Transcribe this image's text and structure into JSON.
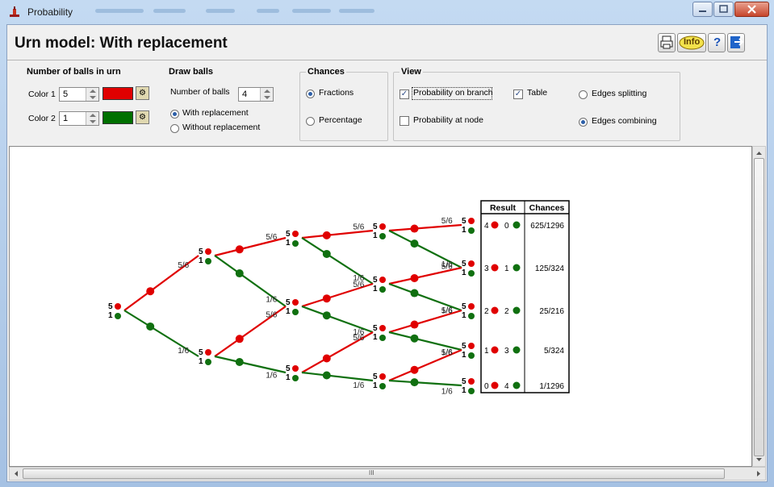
{
  "window": {
    "title": "Probability"
  },
  "header": {
    "title": "Urn model: With replacement",
    "info_label": "Info",
    "help_label": "?"
  },
  "balls": {
    "title": "Number of balls in urn",
    "color1": {
      "label": "Color 1",
      "value": "5",
      "color": "#e00000"
    },
    "color2": {
      "label": "Color 2",
      "value": "1",
      "color": "#007000"
    }
  },
  "draw": {
    "title": "Draw balls",
    "number_label": "Number of balls",
    "number_value": "4",
    "with_replacement": "With replacement",
    "without_replacement": "Without replacement"
  },
  "chances": {
    "title": "Chances",
    "fractions": "Fractions",
    "percentage": "Percentage"
  },
  "view": {
    "title": "View",
    "prob_branch": "Probability on branch",
    "prob_node": "Probability at node",
    "table": "Table",
    "edges_splitting": "Edges splitting",
    "edges_combining": "Edges combining"
  },
  "tree": {
    "red_color": "#e00000",
    "green_color": "#107010",
    "node_counts": {
      "red": "5",
      "green": "1"
    },
    "p_red": "5/6",
    "p_green": "1/6"
  },
  "table": {
    "headers": [
      "Result",
      "Chances"
    ],
    "rows": [
      {
        "red": "4",
        "green": "0",
        "chance": "625/1296"
      },
      {
        "red": "3",
        "green": "1",
        "chance": "125/324"
      },
      {
        "red": "2",
        "green": "2",
        "chance": "25/216"
      },
      {
        "red": "1",
        "green": "3",
        "chance": "5/324"
      },
      {
        "red": "0",
        "green": "4",
        "chance": "1/1296"
      }
    ]
  },
  "scroll": {
    "hscroll_mark": "III"
  }
}
